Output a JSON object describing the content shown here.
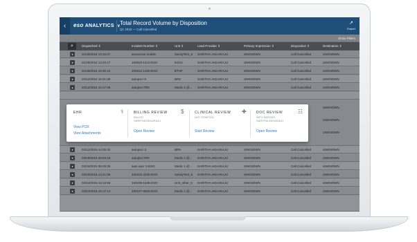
{
  "header": {
    "brand": "eso",
    "product": "ANALYTICS",
    "title": "Total Record Volume by Disposition",
    "subtitle": "Q1 2015 — Call Cancelled",
    "export_label": "Export",
    "export_icon": "export-icon",
    "back_icon": "chevron-left-icon"
  },
  "filter_bar": {
    "show_filters": "Show Filters"
  },
  "table": {
    "columns": [
      "Dispatched ⇕",
      "Incident Number ⇕",
      "Unit ⇕",
      "Lead Provider ⇕",
      "Primary Impression ⇕",
      "Disposition ⇕",
      "Destination ⇕"
    ],
    "rows": [
      [
        "01/29/2015 13:15:07",
        "asosensor.mobile",
        "SandyTest_5",
        "SARITHA AKKARAJU",
        "UNKNOWN",
        "Call Cancelled",
        "UNKNOWN"
      ],
      [
        "01/29/2015 14:20:17",
        "150529-1410-ESO",
        "ESO1",
        "SARITHA AKKARAJU",
        "UNKNOWN",
        "Call Cancelled",
        "UNKNOWN"
      ],
      [
        "01/29/2015 15:30:12",
        "150512-1450-ESO",
        "BTHF",
        "SARITHA AKKARAJU",
        "UNKNOWN",
        "Call Cancelled",
        "UNKNOWN"
      ],
      [
        "03/12/2015 15:31:09",
        "autopscr 5",
        "BR9",
        "SARITHA AKKARAJU",
        "UNKNOWN",
        "Call Cancelled",
        "UNKNOWN"
      ],
      [
        "03/12/2015 16:17:49",
        "autopscr7R0",
        "Medic 2 @...",
        "SARITHA AKKARAJU",
        "UNKNOWN",
        "Call Cancelled",
        "UNKNOWN"
      ],
      [
        "03/12/2015 14:25:32",
        "autopscr 3",
        "BR9",
        "SARITHA AKKARAJU",
        "UNKNOWN",
        "Call Cancelled",
        "UNKNOWN"
      ],
      [
        "03/18/2015 20:53:18",
        "autopscr7R0",
        "Medic 2 @...",
        "SARITHA AKKARAJU",
        "UNKNOWN",
        "Call Cancelled",
        "UNKNOWN"
      ],
      [
        "03/18/2015 09:46:35",
        "auto epcr 2-ESO",
        "Medic 1 @...",
        "SARITHA AKKARAJU",
        "UNKNOWN",
        "Call Cancelled",
        "UNKNOWN"
      ],
      [
        "03/19/2015 13:41:08",
        "150310-2040-ESO",
        "SandyTest_5",
        "SARITHA AKKARAJU",
        "UNKNOWN",
        "Call Cancelled",
        "UNKNOWN"
      ],
      [
        "03/24/2015 15:13:58",
        "150106-1645-ESO",
        "Unit_other_5",
        "SARITHA AKKARAJU",
        "UNKNOWN",
        "Call Cancelled",
        "UNKNOWN"
      ],
      [
        "03/24/2015 16:17:14",
        "150107-0820-ESO",
        "Medic 2 @...",
        "SARITHA AKKARAJU",
        "UNKNOWN",
        "Call Cancelled",
        "UNKNOWN"
      ]
    ]
  },
  "popup": {
    "ehr": {
      "title": "EHR",
      "icon": "caduceus-icon",
      "link1": "View PCR",
      "link2": "View Attachments"
    },
    "billing": {
      "title": "BILLING REVIEW",
      "icon": "dollar-icon",
      "status": "BILLED",
      "user": "SARITHA AKKARAJU",
      "link": "Open Review"
    },
    "clinical": {
      "title": "CLINICAL REVIEW",
      "icon": "medical-kit-icon",
      "status": "NOT STARTED",
      "link": "Start Review"
    },
    "doc": {
      "title": "DOC REVIEW",
      "icon": "clipboard-icon",
      "status": "INFO NEEDED",
      "user": "SARITHA AKKARAJU",
      "link": "Open Review"
    }
  },
  "colors": {
    "header_bg": "#1f4e79",
    "link": "#2a7bd0",
    "table_head": "#4a4d52"
  }
}
